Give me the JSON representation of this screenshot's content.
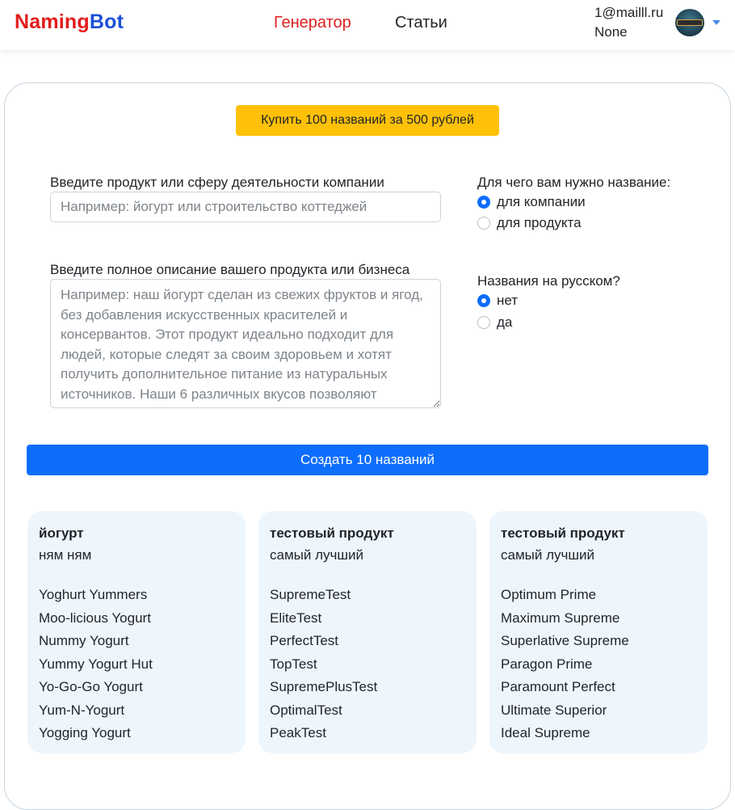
{
  "nav": {
    "brand_part1": "Naming",
    "brand_part2": "Bot",
    "links": [
      "Генератор",
      "Статьи"
    ],
    "user_email": "1@mailll.ru",
    "user_sub": "None"
  },
  "buy_button": "Купить 100 названий за 500 рублей",
  "form": {
    "product_label": "Введите продукт или сферу деятельности компании",
    "product_placeholder": "Например: йогурт или строительство коттеджей",
    "description_label": "Введите полное описание вашего продукта или бизнеса",
    "description_placeholder": "Например: наш йогурт сделан из свежих фруктов и ягод, без добавления искусственных красителей и консервантов. Этот продукт идеально подходит для людей, которые следят за своим здоровьем и хотят получить дополнительное питание из натуральных источников. Наши 6 различных вкусов позволяют",
    "purpose_label": "Для чего вам нужно название:",
    "purpose_options": [
      "для компании",
      "для продукта"
    ],
    "purpose_selected": "для компании",
    "russian_label": "Названия на русском?",
    "russian_options": [
      "нет",
      "да"
    ],
    "russian_selected": "нет",
    "create_button": "Создать 10 названий"
  },
  "results": [
    {
      "title": "йогурт",
      "description": "ням ням",
      "names": [
        "Yoghurt Yummers",
        "Moo-licious Yogurt",
        "Nummy Yogurt",
        "Yummy Yogurt Hut",
        "Yo-Go-Go Yogurt",
        "Yum-N-Yogurt",
        "Yogging Yogurt"
      ]
    },
    {
      "title": "тестовый продукт",
      "description": "самый лучший",
      "names": [
        "SupremeTest",
        "EliteTest",
        "PerfectTest",
        "TopTest",
        "SupremePlusTest",
        "OptimalTest",
        "PeakTest"
      ]
    },
    {
      "title": "тестовый продукт",
      "description": "самый лучший",
      "names": [
        "Optimum Prime",
        "Maximum Supreme",
        "Superlative Supreme",
        "Paragon Prime",
        "Paramount Perfect",
        "Ultimate Superior",
        "Ideal Supreme"
      ]
    }
  ]
}
